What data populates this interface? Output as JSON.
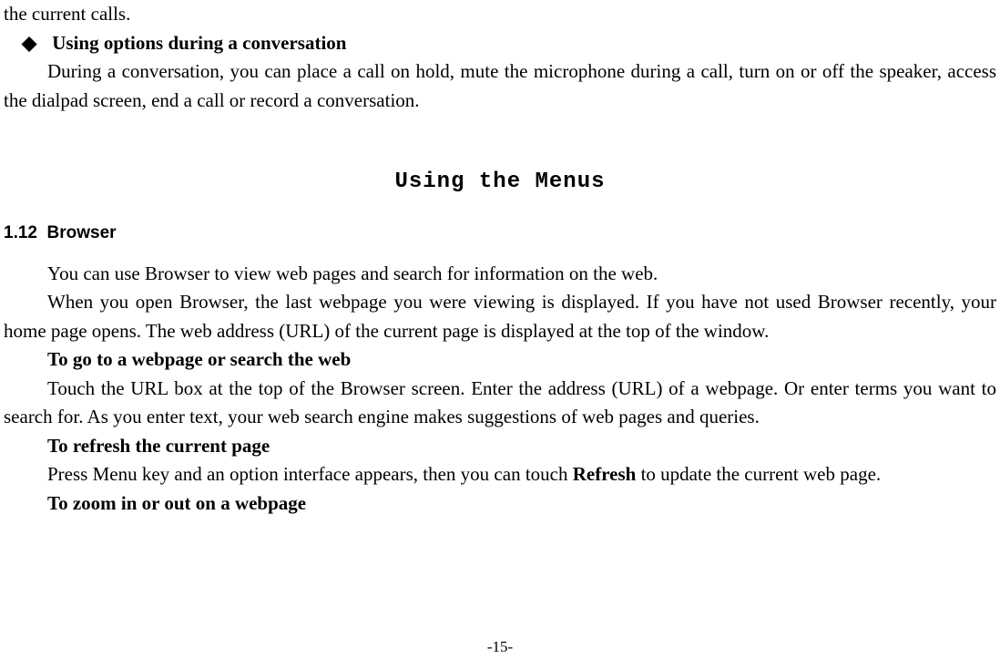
{
  "top_fragment": "the current calls.",
  "bullet": {
    "glyph": "◆",
    "title": "Using options during a conversation"
  },
  "conversation_para": "During a conversation, you can place a call on hold, mute the microphone during a call, turn on or off the speaker, access the dialpad screen, end a call or record a conversation.",
  "chapter_title": "Using the Menus",
  "section": {
    "number": "1.12",
    "title": "Browser"
  },
  "browser_para1": "You can use Browser to view web pages and search for information on the web.",
  "browser_para2": "When you open Browser, the last webpage you were viewing is displayed. If you have not used Browser recently, your home page opens. The web address (URL) of the current page is displayed at the top of the window.",
  "heading_goto": "To go to a webpage or search the web",
  "goto_para": "Touch the URL box at the top of the Browser screen. Enter the address (URL) of a webpage. Or enter terms you want to search for. As you enter text, your web search engine makes suggestions of web pages and queries.",
  "heading_refresh": "To refresh the current page",
  "refresh_para_pre": "Press Menu key and an option interface appears, then you can touch ",
  "refresh_bold": "Refresh",
  "refresh_para_post": " to update the current web page.",
  "heading_zoom": "To zoom in or out on a webpage",
  "page_number": "-15-"
}
